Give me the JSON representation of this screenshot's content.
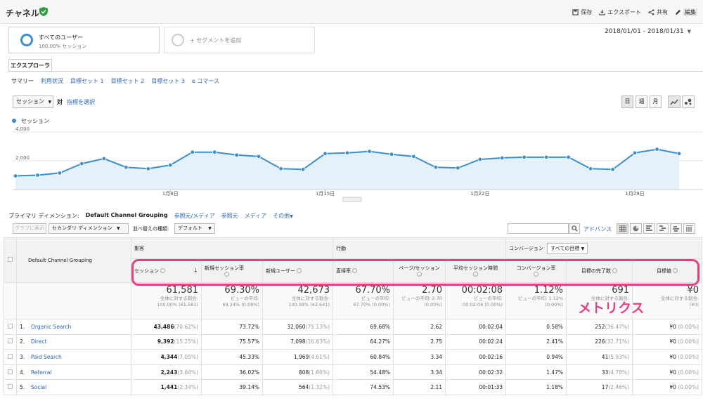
{
  "header": {
    "title": "チャネル",
    "actions": [
      {
        "label": "保存",
        "icon": "save-icon"
      },
      {
        "label": "エクスポート",
        "icon": "export-icon"
      },
      {
        "label": "共有",
        "icon": "share-icon"
      },
      {
        "label": "編集",
        "icon": "edit-icon"
      }
    ]
  },
  "segments": {
    "active_label": "すべてのユーザー",
    "active_sub": "100.00% セッション",
    "add_label": "+ セグメントを追加"
  },
  "date_range": "2018/01/01 - 2018/01/31",
  "tab": "エクスプローラ",
  "subtabs": [
    "サマリー",
    "利用状況",
    "目標セット 1",
    "目標セット 2",
    "目標セット 3",
    "e コマース"
  ],
  "metric_selector": {
    "value": "セッション",
    "vs": "対",
    "pick": "指標を選択"
  },
  "range_buttons": [
    "日",
    "週",
    "月"
  ],
  "chart_data": {
    "type": "line",
    "series": [
      {
        "name": "セッション",
        "values": [
          950,
          1000,
          1150,
          1800,
          2150,
          1550,
          1450,
          1700,
          2600,
          2600,
          2400,
          2300,
          1450,
          1400,
          2500,
          2550,
          2650,
          2450,
          2300,
          1550,
          1500,
          2100,
          2200,
          2250,
          2250,
          2250,
          1450,
          1400,
          2550,
          2800,
          2500
        ]
      }
    ],
    "x": [
      "1/1",
      "1/2",
      "1/3",
      "1/4",
      "1/5",
      "1/6",
      "1/7",
      "1/8",
      "1/9",
      "1/10",
      "1/11",
      "1/12",
      "1/13",
      "1/14",
      "1/15",
      "1/16",
      "1/17",
      "1/18",
      "1/19",
      "1/20",
      "1/21",
      "1/22",
      "1/23",
      "1/24",
      "1/25",
      "1/26",
      "1/27",
      "1/28",
      "1/29",
      "1/30",
      "1/31"
    ],
    "x_ticks": [
      "1月8日",
      "1月15日",
      "1月22日",
      "1月29日"
    ],
    "y_ticks": [
      "2,000",
      "4,000"
    ],
    "ylim": [
      0,
      4000
    ]
  },
  "primary_dim": {
    "label": "プライマリ ディメンション:",
    "value": "Default Channel Grouping",
    "options": [
      "参照元/メディア",
      "参照元",
      "メディア",
      "その他"
    ]
  },
  "controls": {
    "plot_rows": "グラフに表示",
    "secondary": "セカンダリ ディメンション",
    "sort_label": "並べ替えの種類:",
    "sort_value": "デフォルト",
    "advanced": "アドバンス"
  },
  "table": {
    "dim_header": "Default Channel Grouping",
    "groups": {
      "acq": "集客",
      "beh": "行動",
      "conv": "コンバージョン",
      "conv_select": "すべての目標"
    },
    "columns": [
      "セッション",
      "新規セッション率",
      "新規ユーザー",
      "直帰率",
      "ページ/セッション",
      "平均セッション時間",
      "コンバージョン率",
      "目標の完了数",
      "目標値"
    ],
    "totals": [
      {
        "v": "61,581",
        "s1": "全体に対する割合:",
        "s2": "100.00% (61,581)"
      },
      {
        "v": "69.30%",
        "s1": "ビューの平均:",
        "s2": "69.24% (0.08%)"
      },
      {
        "v": "42,673",
        "s1": "全体に対する割合:",
        "s2": "100.08% (42,641)"
      },
      {
        "v": "67.70%",
        "s1": "ビューの平均:",
        "s2": "67.70% (0.00%)"
      },
      {
        "v": "2.70",
        "s1": "ビューの平均: 2.70",
        "s2": "(0.00%)"
      },
      {
        "v": "00:02:08",
        "s1": "ビューの平均:",
        "s2": "00:02:08 (0.00%)"
      },
      {
        "v": "1.12%",
        "s1": "ビューの平均: 1.12%",
        "s2": "(0.00%)"
      },
      {
        "v": "691",
        "s1": "全体に対する割合:",
        "s2": ""
      },
      {
        "v": "¥0",
        "s1": "全体に対する割合:",
        "s2": "(¥0)"
      }
    ],
    "rows": [
      {
        "n": "1.",
        "name": "Organic Search",
        "sess": "43,486",
        "sess_p": "(70.62%)",
        "nsr": "73.72%",
        "nu": "32,060",
        "nu_p": "(75.13%)",
        "br": "69.68%",
        "pps": "2.62",
        "asd": "00:02:04",
        "cr": "0.58%",
        "gc": "252",
        "gc_p": "(36.47%)",
        "gv": "¥0",
        "gv_p": "(0.00%)"
      },
      {
        "n": "2.",
        "name": "Direct",
        "sess": "9,392",
        "sess_p": "(15.25%)",
        "nsr": "75.57%",
        "nu": "7,098",
        "nu_p": "(16.63%)",
        "br": "64.27%",
        "pps": "2.75",
        "asd": "00:02:24",
        "cr": "2.41%",
        "gc": "226",
        "gc_p": "(32.71%)",
        "gv": "¥0",
        "gv_p": "(0.00%)"
      },
      {
        "n": "3.",
        "name": "Paid Search",
        "sess": "4,344",
        "sess_p": "(7.05%)",
        "nsr": "45.33%",
        "nu": "1,969",
        "nu_p": "(4.61%)",
        "br": "60.84%",
        "pps": "3.34",
        "asd": "00:02:16",
        "cr": "0.94%",
        "gc": "41",
        "gc_p": "(5.93%)",
        "gv": "¥0",
        "gv_p": "(0.00%)"
      },
      {
        "n": "4.",
        "name": "Referral",
        "sess": "2,243",
        "sess_p": "(3.64%)",
        "nsr": "36.02%",
        "nu": "808",
        "nu_p": "(1.89%)",
        "br": "54.48%",
        "pps": "3.34",
        "asd": "00:02:32",
        "cr": "1.47%",
        "gc": "33",
        "gc_p": "(4.78%)",
        "gv": "¥0",
        "gv_p": "(0.00%)"
      },
      {
        "n": "5.",
        "name": "Social",
        "sess": "1,441",
        "sess_p": "(2.34%)",
        "nsr": "39.14%",
        "nu": "564",
        "nu_p": "(1.32%)",
        "br": "74.53%",
        "pps": "2.11",
        "asd": "00:01:33",
        "cr": "1.18%",
        "gc": "17",
        "gc_p": "(2.46%)",
        "gv": "¥0",
        "gv_p": "(0.00%)"
      }
    ]
  },
  "annotation": {
    "label": "メトリクス",
    "color": "#e8407f"
  }
}
